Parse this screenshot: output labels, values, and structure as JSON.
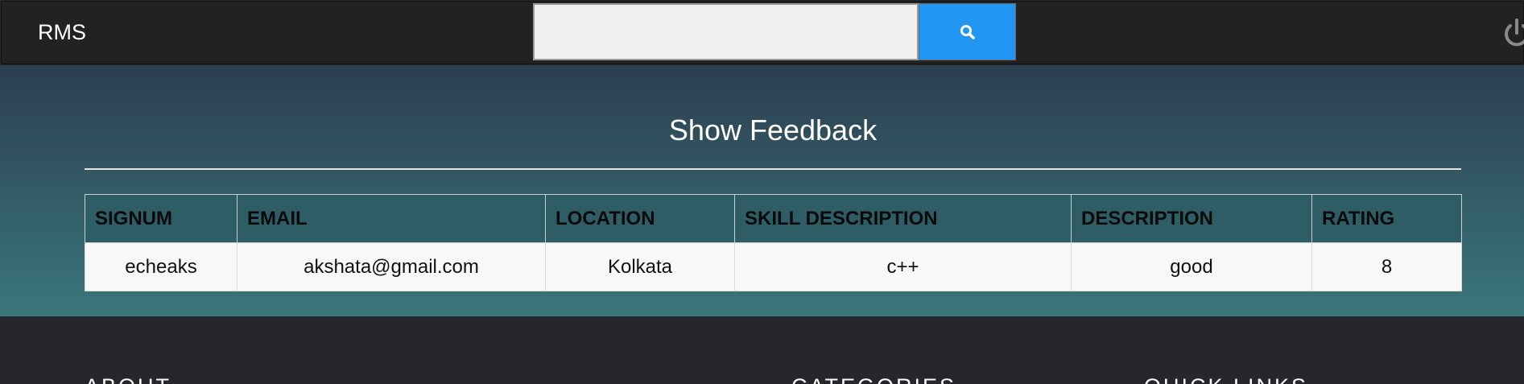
{
  "navbar": {
    "brand": "RMS",
    "search": {
      "placeholder": "",
      "value": "",
      "button_icon": "search-icon"
    },
    "logout_icon": "power-icon"
  },
  "main": {
    "title": "Show Feedback",
    "table": {
      "headers": [
        "SIGNUM",
        "EMAIL",
        "LOCATION",
        "SKILL DESCRIPTION",
        "DESCRIPTION",
        "RATING"
      ],
      "rows": [
        [
          "echeaks",
          "akshata@gmail.com",
          "Kolkata",
          "c++",
          "good",
          "8"
        ]
      ]
    }
  },
  "footer": {
    "headings": [
      "ABOUT",
      "CATEGORIES",
      "QUICK LINKS"
    ]
  },
  "colors": {
    "navbar": "#222222",
    "search_button": "#2196f3",
    "hero_top": "#2c3e50",
    "hero_bottom": "#3a777a",
    "footer": "#25272c"
  }
}
